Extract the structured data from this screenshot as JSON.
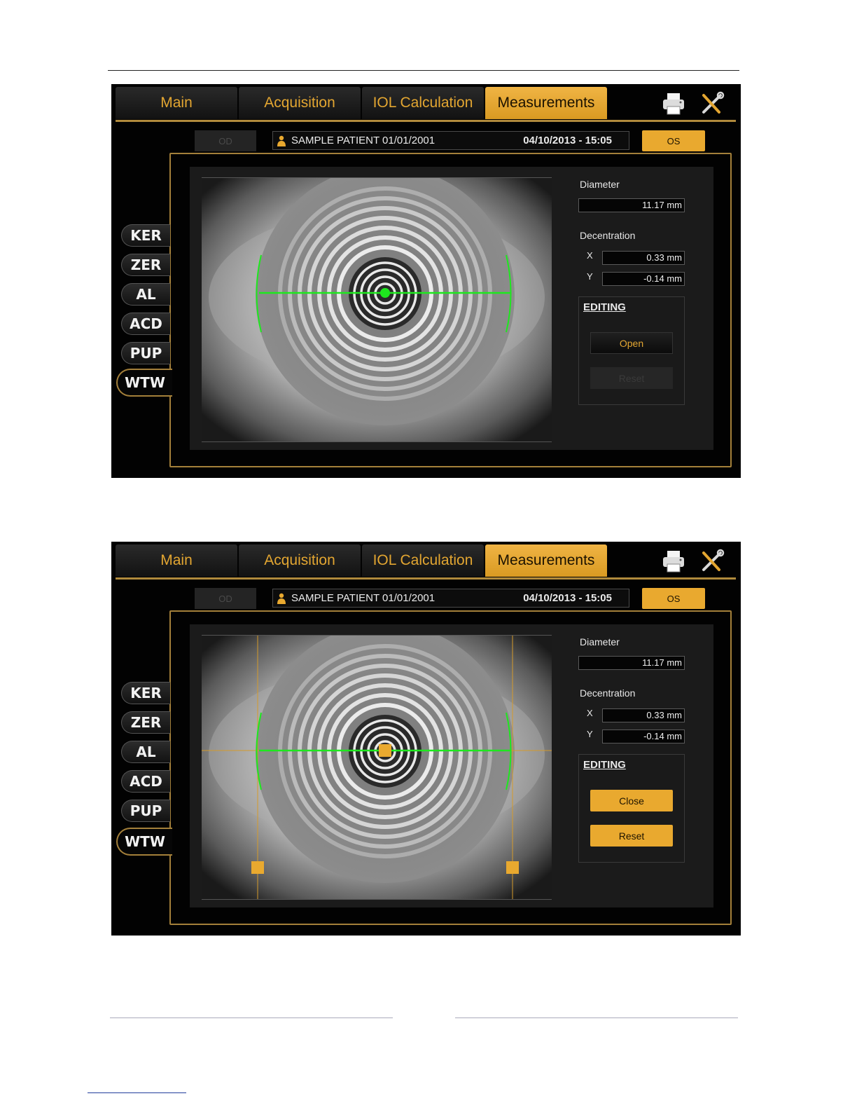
{
  "tabs": [
    "Main",
    "Acquisition",
    "IOL Calculation",
    "Measurements"
  ],
  "icons": {
    "print": "printer-icon",
    "tools": "tools-icon",
    "patient": "person-icon"
  },
  "eye_buttons": {
    "od": "OD",
    "os": "OS"
  },
  "patient": {
    "name": "SAMPLE PATIENT 01/01/2001",
    "datetime": "04/10/2013 - 15:05"
  },
  "side_tabs": [
    "KER",
    "ZER",
    "AL",
    "ACD",
    "PUP",
    "WTW"
  ],
  "measure": {
    "diameter_label": "Diameter",
    "diameter_value": "11.17 mm",
    "decentration_label": "Decentration",
    "x_label": "X",
    "x_value": "0.33 mm",
    "y_label": "Y",
    "y_value": "-0.14 mm"
  },
  "editing": {
    "title": "EDITING",
    "view_closed": {
      "toggle": "Open",
      "reset": "Reset"
    },
    "view_open": {
      "toggle": "Close",
      "reset": "Reset"
    }
  },
  "colors": {
    "accent": "#e9a92f",
    "measure_line": "#1ee81e",
    "frame": "#a4803a"
  }
}
